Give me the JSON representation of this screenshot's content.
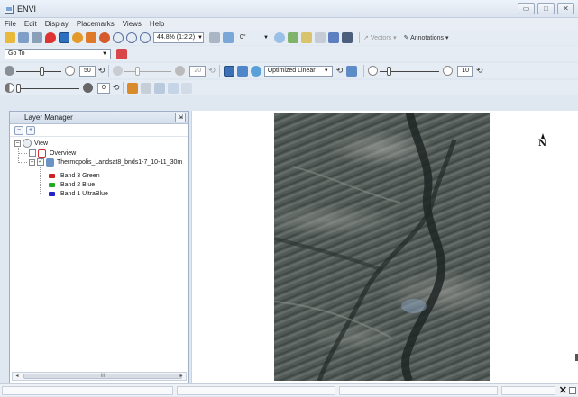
{
  "window": {
    "title": "ENVI",
    "controls": [
      "▭",
      "□",
      "✕"
    ]
  },
  "menu": [
    "File",
    "Edit",
    "Display",
    "Placemarks",
    "Views",
    "Help"
  ],
  "toolbar1": {
    "zoom": "44.8% (1:2.2)",
    "rotation": "0°",
    "vectors_label": "Vectors",
    "annotations_label": "Annotations"
  },
  "goto": {
    "value": "Go To"
  },
  "toolbar3": {
    "brightness": "50",
    "contrast": "20",
    "stretch": "Optimized Linear",
    "sharpen": "10"
  },
  "toolbar4": {
    "transparency": "0"
  },
  "layer_manager": {
    "title": "Layer Manager",
    "tree": {
      "root": "View",
      "overview": "Overview",
      "dataset": "Thermopolis_Landsat8_bnds1-7_10-11_30m",
      "bands": [
        {
          "label": "Band 3 Green",
          "color": "#cc2222"
        },
        {
          "label": "Band 2 Blue",
          "color": "#22aa22"
        },
        {
          "label": "Band 1 UltraBlue",
          "color": "#2222cc"
        }
      ]
    },
    "scroll_thumb": "III"
  },
  "view": {
    "north_label": "N"
  },
  "colors": {
    "accent": "#3b6fb6",
    "background": "#dfe7f1"
  }
}
